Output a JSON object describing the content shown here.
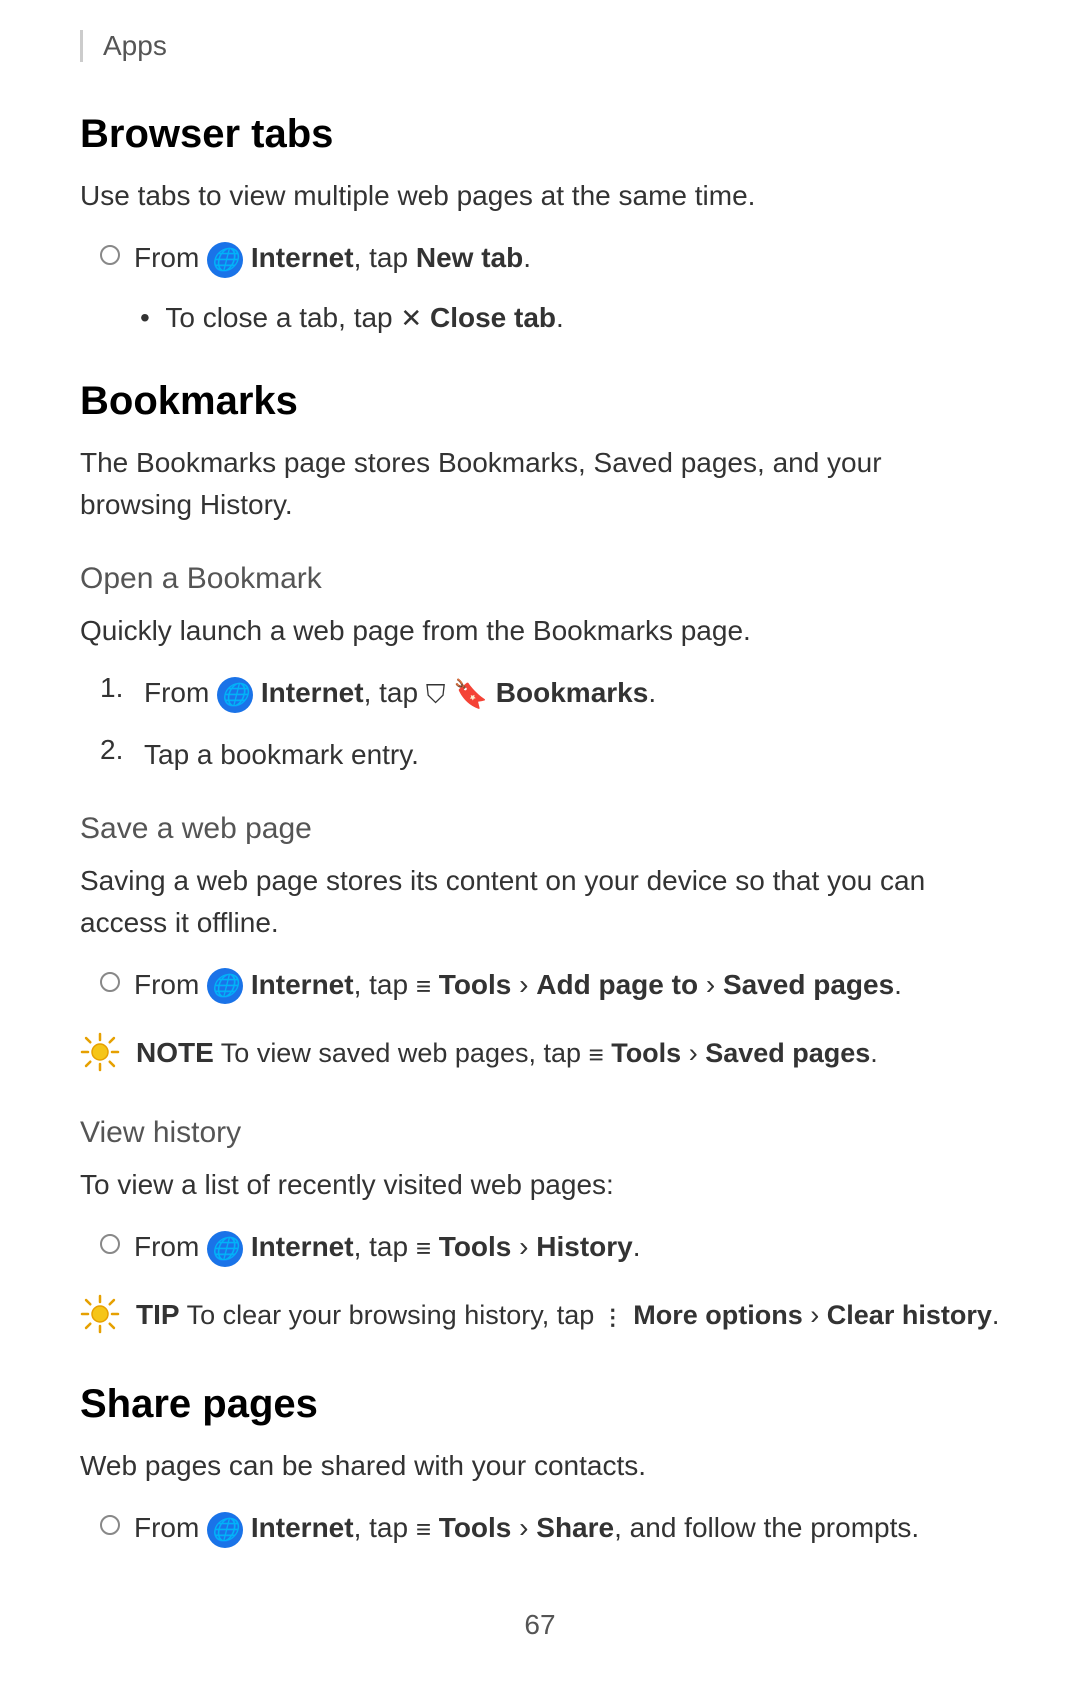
{
  "breadcrumb": {
    "text": "Apps"
  },
  "sections": {
    "browser_tabs": {
      "heading": "Browser tabs",
      "description": "Use tabs to view multiple web pages at the same time.",
      "step1": {
        "prefix": "From",
        "app_name": "Internet",
        "action": ", tap",
        "action_bold": "New tab",
        "action_end": "."
      },
      "substep1": {
        "prefix": "To close a tab, tap",
        "icon_label": "×",
        "action_bold": "Close tab",
        "action_end": "."
      }
    },
    "bookmarks": {
      "heading": "Bookmarks",
      "description": "The Bookmarks page stores Bookmarks, Saved pages, and your browsing History.",
      "open_bookmark": {
        "subheading": "Open a Bookmark",
        "description": "Quickly launch a web page from the Bookmarks page.",
        "step1": {
          "num": "1.",
          "prefix": "From",
          "app_name": "Internet",
          "action": ", tap",
          "icon_label": "☆",
          "action_bold": "Bookmarks",
          "action_end": "."
        },
        "step2": {
          "num": "2.",
          "text": "Tap a bookmark entry."
        }
      },
      "save_web_page": {
        "subheading": "Save a web page",
        "description": "Saving a web page stores its content on your device so that you can access it offline.",
        "step1": {
          "prefix": "From",
          "app_name": "Internet",
          "action": ", tap",
          "tools_icon": "≡",
          "action_bold1": "Tools",
          "chevron": " › ",
          "action_bold2": "Add page to",
          "chevron2": " › ",
          "action_bold3": "Saved pages",
          "action_end": "."
        },
        "note": {
          "label": "NOTE",
          "text": "To view saved web pages, tap",
          "tools_icon": "≡",
          "action_bold1": "Tools",
          "chevron": " › ",
          "action_bold2": "Saved pages",
          "action_end": "."
        }
      },
      "view_history": {
        "subheading": "View history",
        "description": "To view a list of recently visited web pages:",
        "step1": {
          "prefix": "From",
          "app_name": "Internet",
          "action": ", tap",
          "tools_icon": "≡",
          "action_bold1": "Tools",
          "chevron": " › ",
          "action_bold2": "History",
          "action_end": "."
        },
        "tip": {
          "label": "TIP",
          "text": "To clear your browsing history, tap",
          "more_icon": "⋮",
          "action_bold1": "More options",
          "chevron": " › ",
          "action_bold2": "Clear history",
          "action_end": "."
        }
      }
    },
    "share_pages": {
      "heading": "Share pages",
      "description": "Web pages can be shared with your contacts.",
      "step1": {
        "prefix": "From",
        "app_name": "Internet",
        "action": ", tap",
        "tools_icon": "≡",
        "action_bold1": "Tools",
        "chevron": " › ",
        "action_bold2": "Share",
        "action_end": ", and follow the prompts."
      }
    }
  },
  "footer": {
    "page_number": "67"
  }
}
